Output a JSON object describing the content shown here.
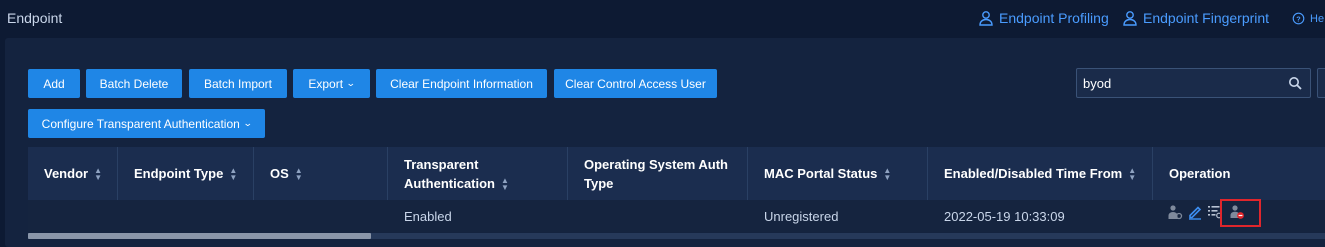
{
  "header": {
    "title": "Endpoint",
    "links": [
      {
        "label": "Endpoint Profiling",
        "icon": "user-icon"
      },
      {
        "label": "Endpoint Fingerprint",
        "icon": "user-icon"
      },
      {
        "label": "He",
        "icon": "help-icon"
      }
    ]
  },
  "toolbar": {
    "add": "Add",
    "batch_delete": "Batch Delete",
    "batch_import": "Batch Import",
    "export": "Export",
    "clear_endpoint_info": "Clear Endpoint Information",
    "clear_control_access_user": "Clear Control Access User",
    "configure_transparent_auth": "Configure Transparent Authentication"
  },
  "search": {
    "value": "byod"
  },
  "table": {
    "columns": [
      {
        "label": "Vendor",
        "sortable": true
      },
      {
        "label": "Endpoint Type",
        "sortable": true
      },
      {
        "label": "OS",
        "sortable": true
      },
      {
        "label": "Transparent Authentication",
        "sortable": true
      },
      {
        "label": "Operating System Auth Type",
        "sortable": false
      },
      {
        "label": "MAC Portal Status",
        "sortable": true
      },
      {
        "label": "Enabled/Disabled Time From",
        "sortable": true
      },
      {
        "label": "Operation",
        "sortable": false
      }
    ],
    "rows": [
      {
        "vendor": "",
        "endpoint_type": "",
        "os": "",
        "transparent_authentication": "Enabled",
        "os_auth_type": "",
        "mac_portal_status": "Unregistered",
        "time_from": "2022-05-19 10:33:09",
        "operations": [
          "user-auth-icon",
          "edit-icon",
          "detail-list-icon",
          "user-block-icon"
        ]
      }
    ]
  },
  "colors": {
    "background": "#0d1a33",
    "panel": "#14233f",
    "primary_button": "#1f86e6",
    "link": "#4a9cff",
    "highlight": "#e0262c"
  }
}
